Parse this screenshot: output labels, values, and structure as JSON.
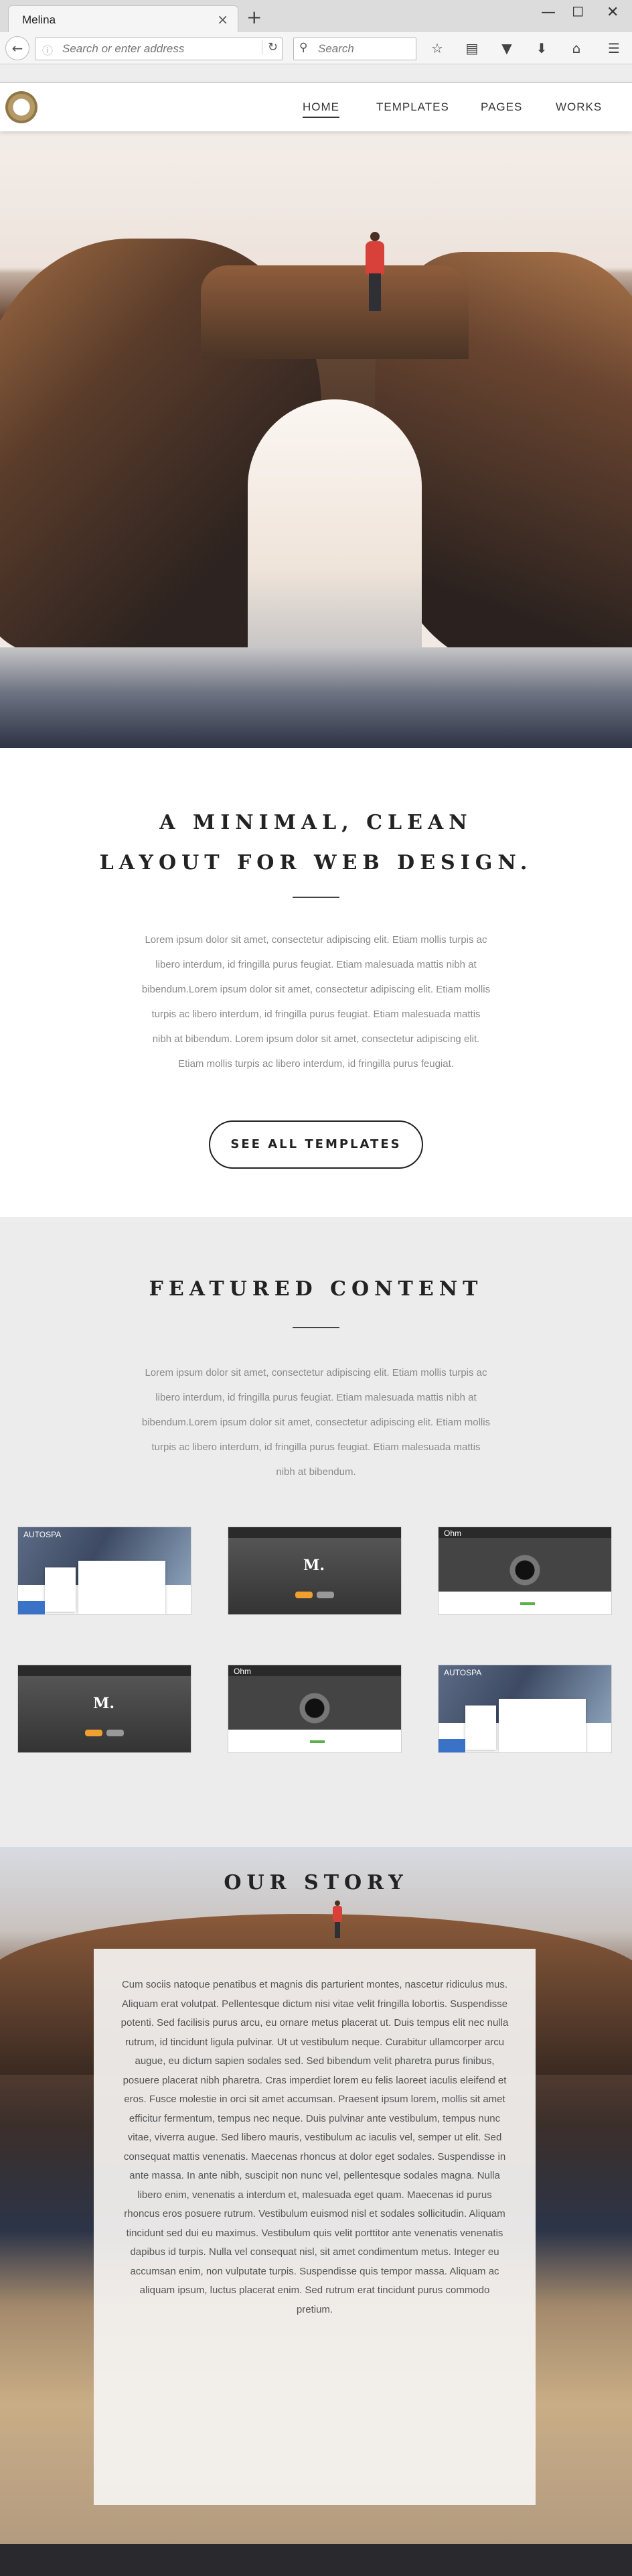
{
  "browser": {
    "tab_title": "Melina",
    "tab_close_glyph": "×",
    "new_tab_glyph": "+",
    "url_placeholder": "Search or enter address",
    "search_placeholder": "Search",
    "icons": [
      "back-icon",
      "info-icon",
      "reload-icon",
      "search-icon",
      "bookmark-star-icon",
      "reading-list-icon",
      "pocket-icon",
      "download-icon",
      "home-icon",
      "hamburger-menu-icon",
      "minimize-icon",
      "maximize-icon",
      "close-window-icon"
    ]
  },
  "site": {
    "logo": "melina-logo-icon",
    "nav": [
      {
        "label": "HOME",
        "active": true
      },
      {
        "label": "TEMPLATES",
        "active": false
      },
      {
        "label": "PAGES",
        "active": false
      },
      {
        "label": "WORKS",
        "active": false
      }
    ]
  },
  "intro": {
    "title_line1": "A MINIMAL, CLEAN",
    "title_line2": "LAYOUT FOR WEB DESIGN.",
    "body_lines": [
      "Lorem ipsum dolor sit amet, consectetur adipiscing elit. Etiam mollis turpis ac",
      "libero interdum, id fringilla purus feugiat. Etiam malesuada mattis nibh at",
      "bibendum.Lorem ipsum dolor sit amet, consectetur adipiscing elit. Etiam mollis",
      "turpis ac libero interdum, id fringilla purus feugiat. Etiam malesuada mattis",
      "nibh at bibendum. Lorem ipsum dolor sit amet, consectetur adipiscing elit.",
      "Etiam mollis turpis ac libero interdum, id fringilla purus feugiat."
    ],
    "button_label": "SEE ALL TEMPLATES"
  },
  "featured": {
    "title": "FEATURED CONTENT",
    "body_lines": [
      "Lorem ipsum dolor sit amet, consectetur adipiscing elit. Etiam mollis turpis ac",
      "libero interdum, id fringilla purus feugiat. Etiam malesuada mattis nibh at",
      "bibendum.Lorem ipsum dolor sit amet, consectetur adipiscing elit. Etiam mollis",
      "turpis ac libero interdum, id fringilla purus feugiat. Etiam malesuada mattis",
      "nibh at bibendum."
    ],
    "thumbnails": [
      {
        "kind": "autospa",
        "brand": "AUTOSPA"
      },
      {
        "kind": "dark-m",
        "brand": "M."
      },
      {
        "kind": "camera",
        "brand": "Ohm"
      },
      {
        "kind": "dark-m",
        "brand": "M."
      },
      {
        "kind": "camera",
        "brand": "Ohm"
      },
      {
        "kind": "autospa",
        "brand": "AUTOSPA"
      }
    ]
  },
  "story": {
    "title": "OUR STORY",
    "body": "Cum sociis natoque penatibus et magnis dis parturient montes, nascetur ridiculus mus. Aliquam erat volutpat. Pellentesque dictum nisi vitae velit fringilla lobortis. Suspendisse potenti. Sed facilisis purus arcu, eu ornare metus placerat ut. Duis tempus elit nec nulla rutrum, id tincidunt ligula pulvinar. Ut ut vestibulum neque. Curabitur ullamcorper arcu augue, eu dictum sapien sodales sed. Sed bibendum velit pharetra purus finibus, posuere placerat nibh pharetra. Cras imperdiet lorem eu felis laoreet iaculis eleifend et eros. Fusce molestie in orci sit amet accumsan. Praesent ipsum lorem, mollis sit amet efficitur fermentum, tempus nec neque. Duis pulvinar ante vestibulum, tempus nunc vitae, viverra augue. Sed libero mauris, vestibulum ac iaculis vel, semper ut elit. Sed consequat mattis venenatis. Maecenas rhoncus at dolor eget sodales. Suspendisse in ante massa. In ante nibh, suscipit non nunc vel, pellentesque sodales magna. Nulla libero enim, venenatis a interdum et, malesuada eget quam. Maecenas id purus rhoncus eros posuere rutrum. Vestibulum euismod nisl et sodales sollicitudin. Aliquam tincidunt sed dui eu maximus. Vestibulum quis velit porttitor ante venenatis venenatis dapibus id turpis. Nulla vel consequat nisl, sit amet condimentum metus. Integer eu accumsan enim, non vulputate turpis. Suspendisse quis tempor massa. Aliquam ac aliquam ipsum, luctus placerat enim. Sed rutrum erat tincidunt purus commodo pretium."
  }
}
